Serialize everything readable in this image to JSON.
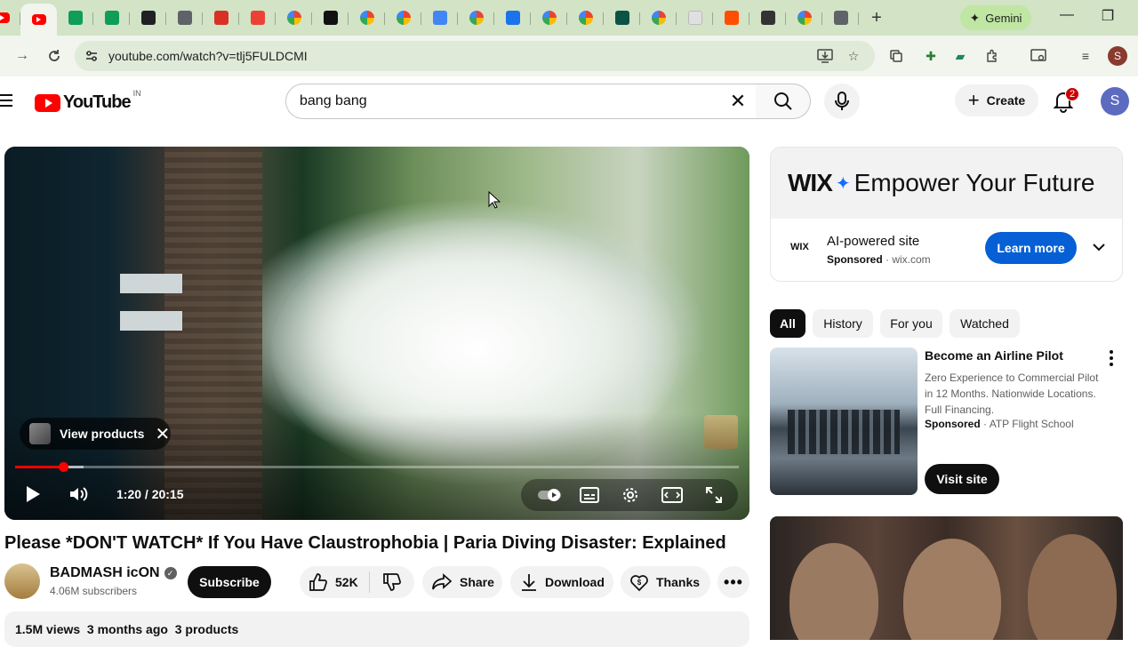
{
  "browser": {
    "tabs": [
      {
        "icon": "youtube-favicon",
        "color": "#ff0000",
        "active": false
      },
      {
        "icon": "youtube-favicon",
        "color": "#ff0000",
        "active": true
      },
      {
        "icon": "sheets-favicon",
        "color": "#0f9d58"
      },
      {
        "icon": "sheets-favicon",
        "color": "#0f9d58"
      },
      {
        "icon": "openai-favicon",
        "color": "#202124"
      },
      {
        "icon": "chart-favicon",
        "color": "#5f6368"
      },
      {
        "icon": "pdf-favicon",
        "color": "#d93025"
      },
      {
        "icon": "gmail-favicon",
        "color": "#ea4335"
      },
      {
        "icon": "google-favicon",
        "color": "#4285f4"
      },
      {
        "icon": "f-favicon",
        "color": "#111111"
      },
      {
        "icon": "google-favicon",
        "color": "#4285f4"
      },
      {
        "icon": "google-favicon",
        "color": "#4285f4"
      },
      {
        "icon": "docs-favicon",
        "color": "#4285f4"
      },
      {
        "icon": "google-favicon",
        "color": "#4285f4"
      },
      {
        "icon": "drive-favicon",
        "color": "#1a73e8"
      },
      {
        "icon": "google-favicon",
        "color": "#4285f4"
      },
      {
        "icon": "google-favicon",
        "color": "#4285f4"
      },
      {
        "icon": "circle-favicon",
        "color": "#0b5345"
      },
      {
        "icon": "google-favicon",
        "color": "#4285f4"
      },
      {
        "icon": "blank-favicon",
        "color": "#e0e0e0"
      },
      {
        "icon": "ars-favicon",
        "color": "#ff4e00"
      },
      {
        "icon": "g-favicon",
        "color": "#333333"
      },
      {
        "icon": "google-favicon",
        "color": "#4285f4"
      },
      {
        "icon": "chrome-favicon",
        "color": "#5f6368"
      }
    ],
    "gemini_label": "Gemini",
    "url": "youtube.com/watch?v=tlj5FULDCMI",
    "profile_initial": "S"
  },
  "youtube": {
    "logo_text": "YouTube",
    "country_code": "IN",
    "search_query": "bang bang",
    "create_label": "Create",
    "notification_count": "2",
    "avatar_initial": "S"
  },
  "player": {
    "view_products_label": "View products",
    "time_display": "1:20 / 20:15",
    "progress_fraction": 0.066,
    "buffer_fraction": 0.095
  },
  "video": {
    "title": "Please *DON'T WATCH* If You Have Claustrophobia | Paria Diving Disaster: Explained",
    "channel_name": "BADMASH icON",
    "subscribers": "4.06M subscribers",
    "subscribe_label": "Subscribe",
    "likes": "52K",
    "share_label": "Share",
    "download_label": "Download",
    "thanks_label": "Thanks",
    "meta": "1.5M views  3 months ago  3 products"
  },
  "ad": {
    "banner_brand": "WIX",
    "banner_tagline": "Empower Your Future",
    "logo_text": "WIX",
    "title": "AI-powered site",
    "sponsored": "Sponsored",
    "domain": "wix.com",
    "cta": "Learn more"
  },
  "chips": [
    "All",
    "History",
    "For you",
    "Watched"
  ],
  "sponsored_card": {
    "title": "Become an Airline Pilot",
    "description": "Zero Experience to Commercial Pilot in 12 Months. Nationwide Locations. Full Financing.",
    "sponsored": "Sponsored",
    "advertiser": "ATP Flight School",
    "cta": "Visit site"
  },
  "colors": {
    "youtube_red": "#ff0000",
    "chrome_frame": "#d3e3c6",
    "link_blue": "#065fd4"
  }
}
